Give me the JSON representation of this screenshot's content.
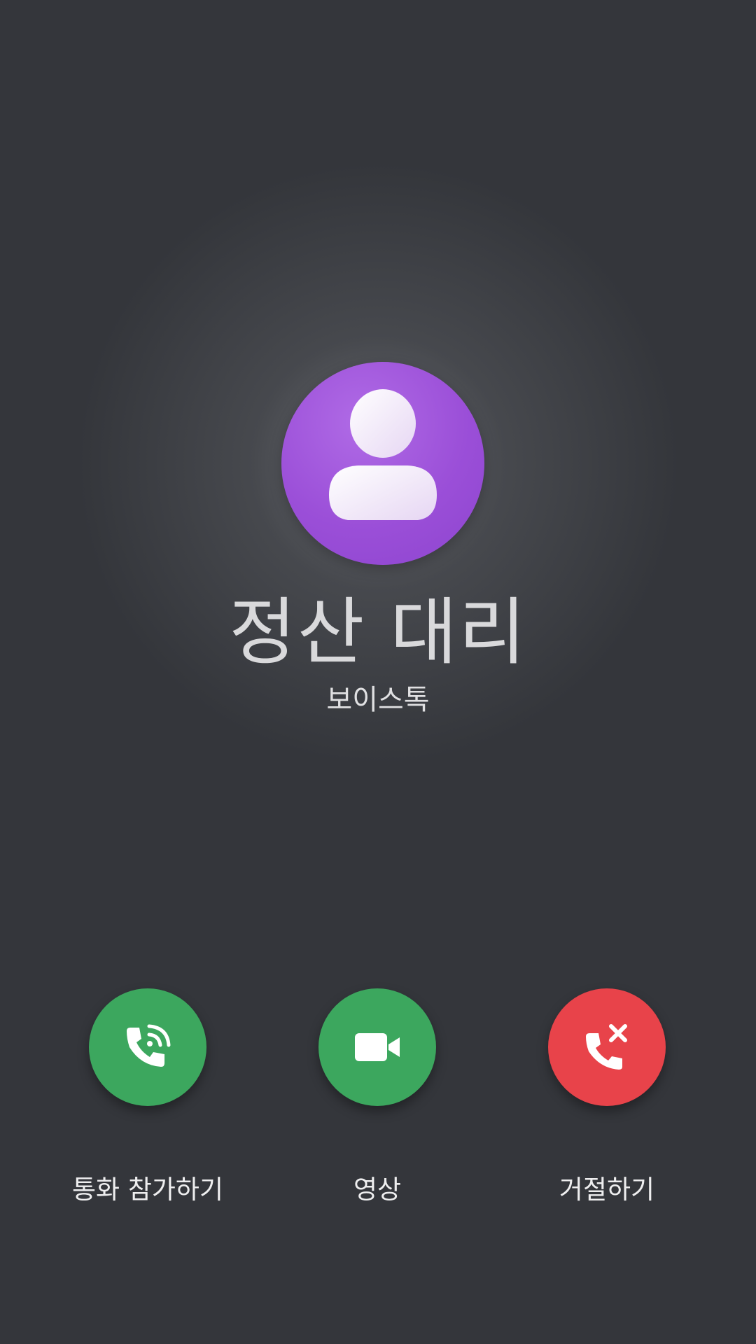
{
  "caller": {
    "name": "정산 대리",
    "call_type": "보이스톡",
    "avatar_icon": "person-silhouette-icon",
    "avatar_color": "#9b4fd8"
  },
  "actions": {
    "join": {
      "label": "통화 참가하기",
      "icon": "phone-signal-icon",
      "color": "#3ca75e"
    },
    "video": {
      "label": "영상",
      "icon": "video-camera-icon",
      "color": "#3ca75e"
    },
    "decline": {
      "label": "거절하기",
      "icon": "phone-decline-icon",
      "color": "#e8434a"
    }
  },
  "theme": {
    "background": "#34363b"
  }
}
